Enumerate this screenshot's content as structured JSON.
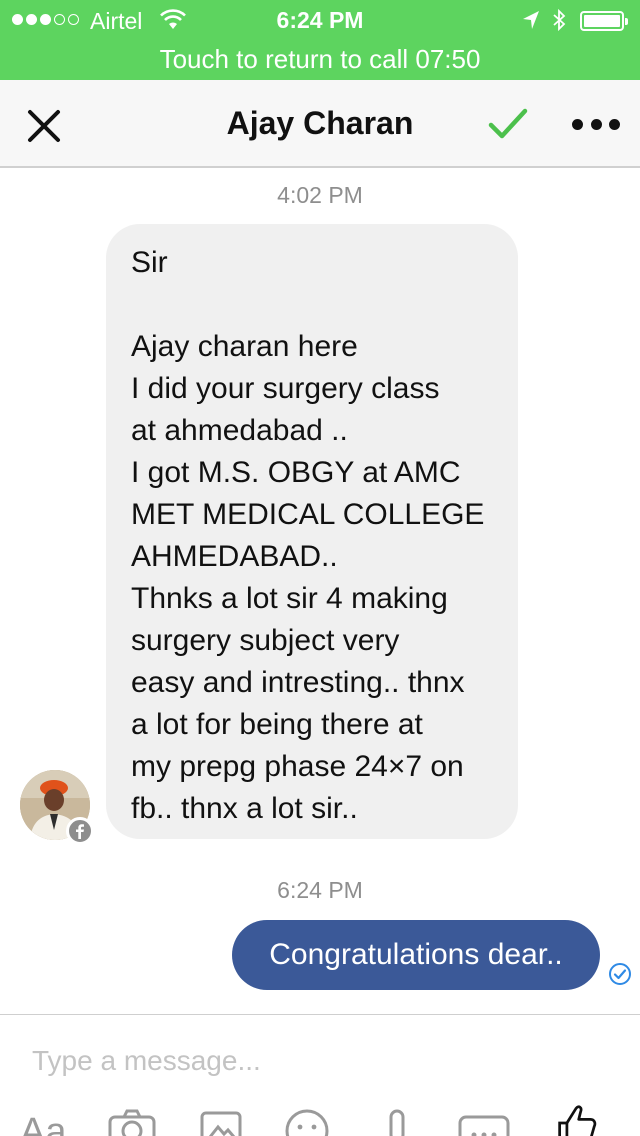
{
  "status_bar": {
    "carrier": "Airtel",
    "time": "6:24 PM",
    "call_banner": "Touch to return to call 07:50"
  },
  "header": {
    "title": "Ajay Charan",
    "close_icon": "close-icon",
    "check_icon": "checkmark-icon",
    "more_icon": "more-options-icon",
    "accent_color": "#4cc04c"
  },
  "conversation": {
    "timestamp_1": "4:02 PM",
    "incoming_message": "Sir\n\nAjay charan here\nI did your surgery class\nat ahmedabad ..\nI got M.S. OBGY at AMC\nMET MEDICAL COLLEGE\nAHMEDABAD..\nThnks a lot sir 4 making\nsurgery subject very\neasy and intresting.. thnx\na lot for being there at\nmy prepg phase 24×7 on\nfb.. thnx a lot sir..",
    "timestamp_2": "6:24 PM",
    "outgoing_message": "Congratulations dear..",
    "outgoing_color": "#3b5998"
  },
  "composer": {
    "placeholder": "Type a message...",
    "toolbar_aa": "Aa",
    "toolbar_icons": [
      "camera-icon",
      "gallery-icon",
      "emoji-icon",
      "microphone-icon",
      "more-apps-icon",
      "like-icon"
    ]
  }
}
